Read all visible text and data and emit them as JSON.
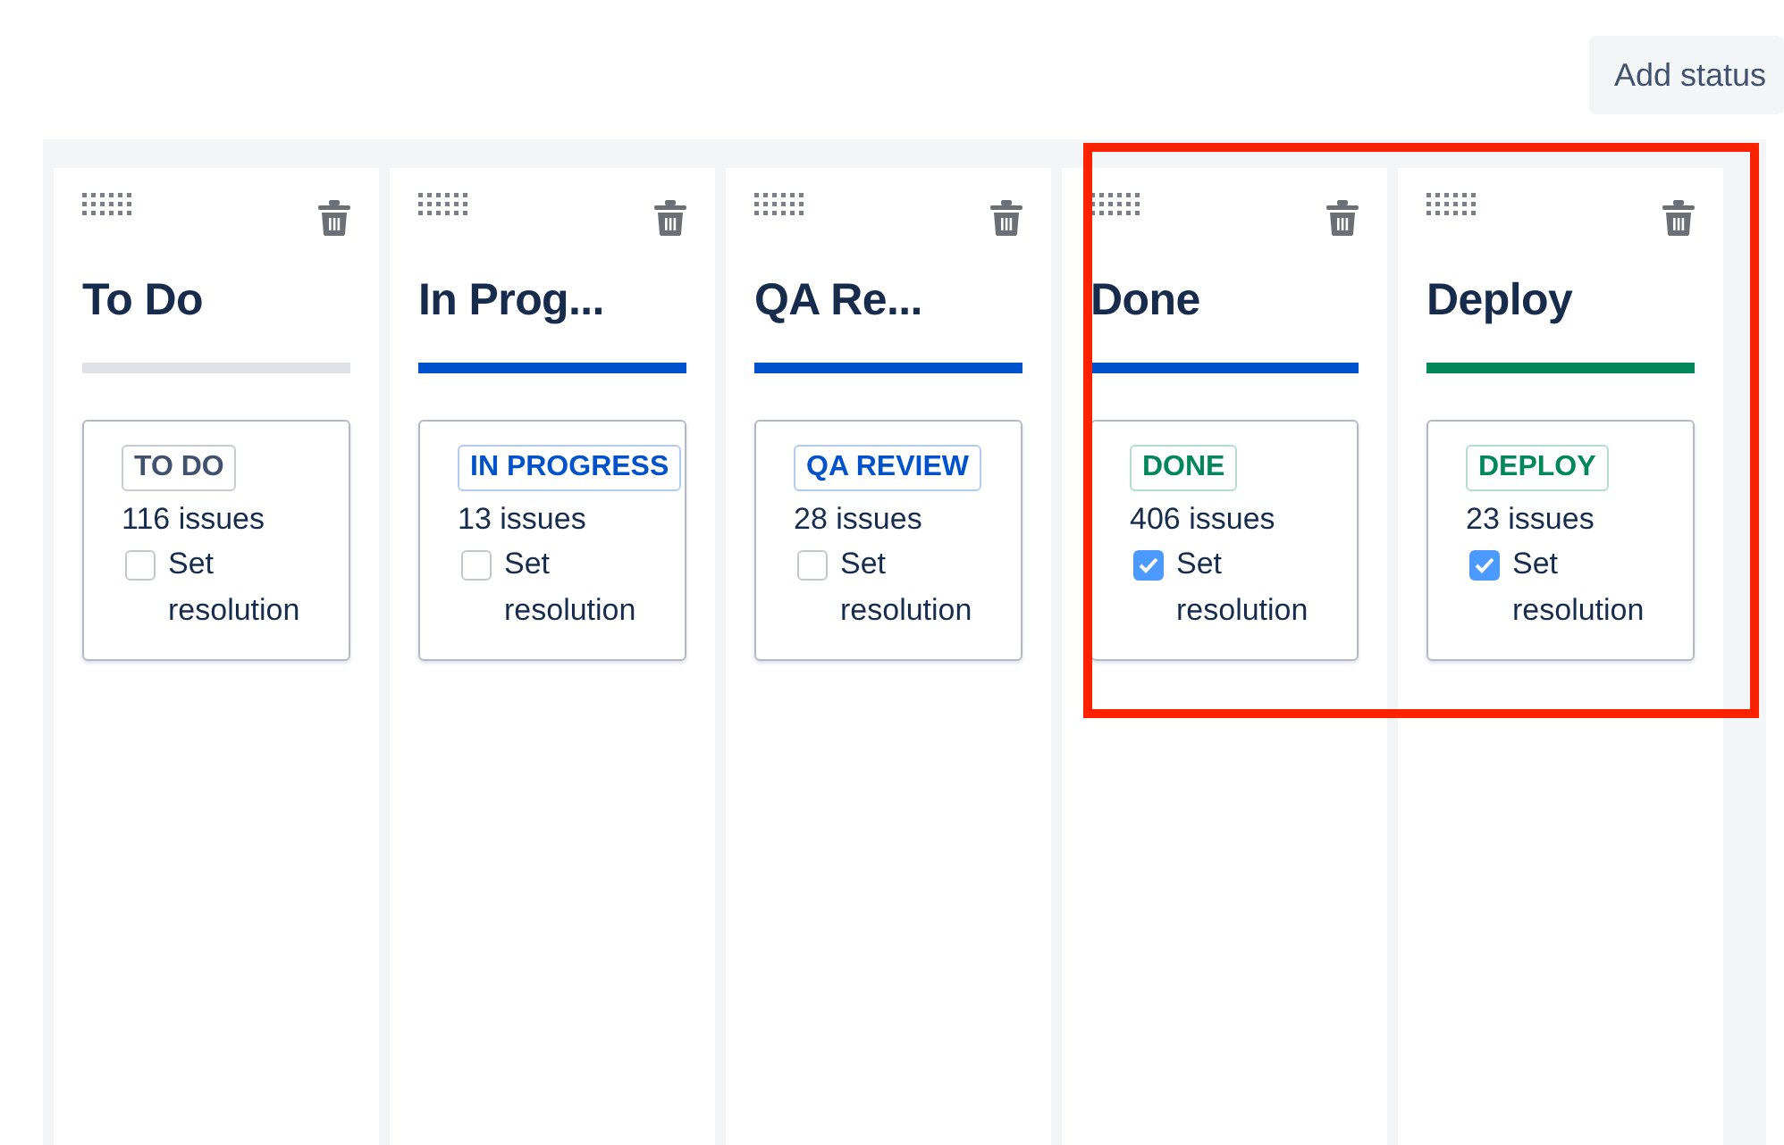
{
  "add_status_button": "Add status",
  "columns": [
    {
      "title": "To Do",
      "color": "#dfe1e6",
      "status": {
        "label": "TO DO",
        "color": "#42526e"
      },
      "count": "116 issues",
      "resolution_label": "Set resolution",
      "checked": false,
      "highlighted": false
    },
    {
      "title": "In Prog...",
      "color": "#0052cc",
      "status": {
        "label": "IN PROGRESS",
        "color": "#0052cc"
      },
      "count": "13 issues",
      "resolution_label": "Set resolution",
      "checked": false,
      "highlighted": false
    },
    {
      "title": "QA Re...",
      "color": "#0052cc",
      "status": {
        "label": "QA REVIEW",
        "color": "#0052cc"
      },
      "count": "28 issues",
      "resolution_label": "Set resolution",
      "checked": false,
      "highlighted": false
    },
    {
      "title": "Done",
      "color": "#0052cc",
      "status": {
        "label": "DONE",
        "color": "#00875a"
      },
      "count": "406 issues",
      "resolution_label": "Set resolution",
      "checked": true,
      "highlighted": true
    },
    {
      "title": "Deploy",
      "color": "#00875a",
      "status": {
        "label": "DEPLOY",
        "color": "#00875a"
      },
      "count": "23 issues",
      "resolution_label": "Set resolution",
      "checked": true,
      "highlighted": true
    }
  ]
}
